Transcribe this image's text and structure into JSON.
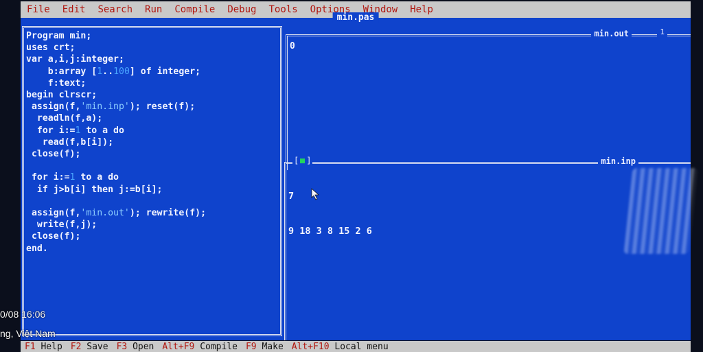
{
  "menu": [
    "File",
    "Edit",
    "Search",
    "Run",
    "Compile",
    "Debug",
    "Tools",
    "Options",
    "Window",
    "Help"
  ],
  "editor": {
    "title": "min.pas",
    "code": [
      "Program min;",
      "uses crt;",
      "var a,i,j:integer;",
      "    b:array [1..100] of integer;",
      "    f:text;",
      "begin clrscr;",
      " assign(f,'min.inp'); reset(f);",
      "  readln(f,a);",
      "  for i:=1 to a do",
      "   read(f,b[i]);",
      " close(f);",
      "",
      " for i:=1 to a do",
      "  if j>b[i] then j:=b[i];",
      "",
      " assign(f,'min.out'); rewrite(f);",
      "  write(f,j);",
      " close(f);",
      "end."
    ]
  },
  "output_window": {
    "title": "min.out",
    "number": "1",
    "content": "0"
  },
  "input_window": {
    "title": "min.inp",
    "content_lines": [
      "7",
      "9 18 3 8 15 2 6"
    ]
  },
  "status": [
    {
      "key": "F1",
      "label": "Help"
    },
    {
      "key": "F2",
      "label": "Save"
    },
    {
      "key": "F3",
      "label": "Open"
    },
    {
      "key": "Alt+F9",
      "label": "Compile"
    },
    {
      "key": "F9",
      "label": "Make"
    },
    {
      "key": "Alt+F10",
      "label": "Local menu"
    }
  ],
  "overlay": {
    "line1": "0/08 16:06",
    "line2": "ng, Việt Nam"
  },
  "colors": {
    "desktop": "#0f43cc",
    "menubar": "#c9c9c9",
    "hotkey": "#b0160f"
  }
}
